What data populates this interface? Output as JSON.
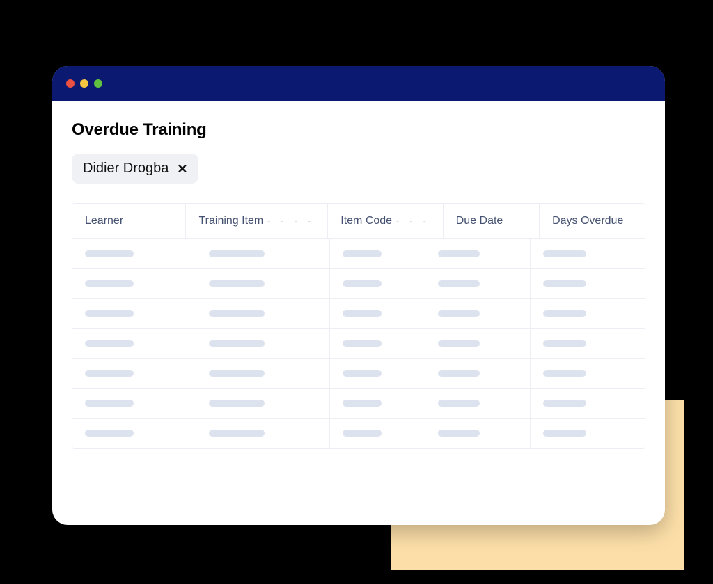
{
  "colors": {
    "titlebar": "#0b1a70",
    "accent_square": "#fcdfa8",
    "skeleton": "#dde3ee",
    "border": "#eceef3",
    "header_text": "#455170"
  },
  "window": {
    "traffic_lights": [
      "red",
      "yellow",
      "green"
    ]
  },
  "page": {
    "title": "Overdue Training"
  },
  "filter_chip": {
    "label": "Didier Drogba"
  },
  "table": {
    "columns": [
      {
        "label": "Learner"
      },
      {
        "label": "Training Item"
      },
      {
        "label": "Item Code"
      },
      {
        "label": "Due Date"
      },
      {
        "label": "Days Overdue"
      }
    ],
    "placeholder_row_count": 7
  }
}
